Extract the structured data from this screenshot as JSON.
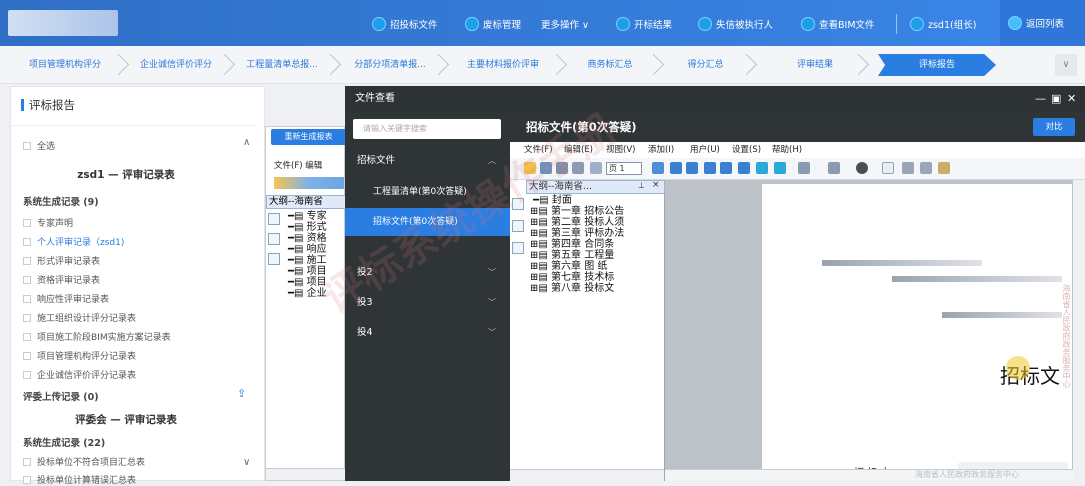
{
  "topbar": {
    "nav": [
      {
        "label": "招投标文件",
        "icon": "file-icon"
      },
      {
        "label": "废标管理",
        "icon": "file-icon"
      },
      {
        "label": "更多操作 ∨",
        "icon": ""
      },
      {
        "label": "开标结果",
        "icon": "file-icon"
      },
      {
        "label": "失信被执行人",
        "icon": "file-icon"
      },
      {
        "label": "查看BIM文件",
        "icon": "file-icon"
      },
      {
        "label": "zsd1(组长)",
        "icon": "user-icon"
      },
      {
        "label": "返回列表",
        "icon": "return-icon"
      }
    ]
  },
  "tabs": [
    {
      "label": "项目管理机构评分"
    },
    {
      "label": "企业诚信评价评分"
    },
    {
      "label": "工程量清单总报..."
    },
    {
      "label": "分部分项清单报..."
    },
    {
      "label": "主要材料报价评审"
    },
    {
      "label": "商务标汇总"
    },
    {
      "label": "得分汇总"
    },
    {
      "label": "评审结果"
    },
    {
      "label": "评标报告",
      "active": true
    }
  ],
  "tabs_more": "∨",
  "left": {
    "title": "评标报告",
    "select_all": "全选",
    "section1_title": "zsd1 — 评审记录表",
    "sys_records": "系统生成记录 (9)",
    "sys_items": [
      "专家声明",
      "个人评审记录（zsd1)",
      "形式评审记录表",
      "资格评审记录表",
      "响应性评审记录表",
      "施工组织设计评分记录表",
      "项目施工阶段BIM实施方案记录表",
      "项目管理机构评分记录表",
      "企业诚信评价评分记录表"
    ],
    "upload_records": "评委上传记录 (0)",
    "section2_title": "评委会 — 评审记录表",
    "sys_records2": "系统生成记录 (22)",
    "sys_items2": [
      "投标单位不符合项目汇总表",
      "投标单位计算错误汇总表"
    ]
  },
  "middle": {
    "regen_button": "重新生成报表",
    "menu": "文件(F)  编辑",
    "outline_header": "大纲--海南省",
    "tree": [
      "专家",
      "形式",
      "资格",
      "响应",
      "施工",
      "项目",
      "项目",
      "企业"
    ]
  },
  "viewer": {
    "title": "文件查看",
    "controls": [
      "—",
      "▣",
      "✕"
    ],
    "search_placeholder": "请输入关键字搜索",
    "groups": [
      {
        "label": "招标文件",
        "chev": "︿",
        "expanded": true,
        "children": [
          "工程量清单(第0次答疑)",
          "招标文件(第0次答疑)"
        ]
      },
      {
        "label": "投2",
        "chev": "﹀"
      },
      {
        "label": "投3",
        "chev": "﹀"
      },
      {
        "label": "投4",
        "chev": "﹀"
      }
    ],
    "doc_title": "招标文件(第0次答疑)",
    "compare_button": "对比",
    "doc_menu": [
      "文件(F)",
      "编辑(E)",
      "视图(V)",
      "添加(I)",
      "用户(U)",
      "设置(S)",
      "帮助(H)"
    ],
    "page_field": "页 1",
    "outline_header": "大纲--海南省...",
    "outline_items": [
      "封面",
      "第一章  招标公告",
      "第二章  投标人须",
      "第三章  评标办法",
      "第四章    合同条",
      "第五章    工程量",
      "第六章    图    纸",
      "第七章    技术标",
      "第八章    投标文"
    ],
    "page_heading": "招标文",
    "page_sub": "招  标  人",
    "page_footer": "海南省人民政府政务服务中心",
    "page_side": "海南省人民政府政务服务中心"
  },
  "watermark": "评标系统操作手册",
  "colors": {
    "primary": "#2a7de1",
    "dark": "#2f3437",
    "topbar": "#3a86e8"
  }
}
